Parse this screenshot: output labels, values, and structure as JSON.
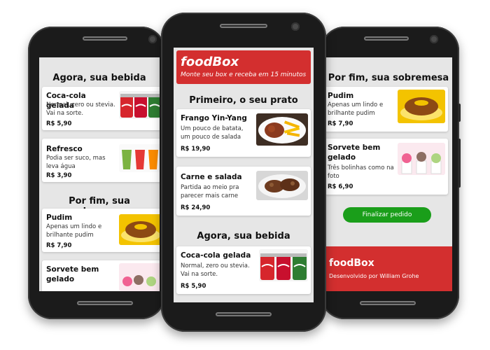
{
  "app": {
    "brand": "foodBox",
    "tagline": "Monte seu box e receba em 15 minutos",
    "credit": "Desenvolvido por William Grohe",
    "finish_button": "Finalizar pedido"
  },
  "sections": {
    "main": "Primeiro, o seu prato",
    "drinks": "Agora, sua bebida",
    "desserts": "Por fim, sua sobremesa"
  },
  "items": {
    "frango": {
      "name": "Frango Yin-Yang",
      "desc": "Um pouco de batata, um pouco de salada",
      "price": "R$ 19,90"
    },
    "carne": {
      "name": "Carne e salada",
      "desc": "Partida ao meio pra parecer mais carne",
      "price": "R$ 24,90"
    },
    "coca": {
      "name": "Coca-cola gelada",
      "desc": "Normal, zero ou stevia. Vai na sorte.",
      "price": "R$ 5,90"
    },
    "refresco": {
      "name": "Refresco",
      "desc": "Podia ser suco, mas leva água",
      "price": "R$ 3,90"
    },
    "pudim": {
      "name": "Pudim",
      "desc": "Apenas um lindo e brilhante pudim",
      "price": "R$ 7,90"
    },
    "sorvete": {
      "name": "Sorvete bem gelado",
      "desc": "Três bolinhas como na foto",
      "price": "R$ 6,90"
    }
  },
  "colors": {
    "red": "#d32f2f",
    "green": "#1a9e1a",
    "screen_bg": "#e6e6e6"
  }
}
